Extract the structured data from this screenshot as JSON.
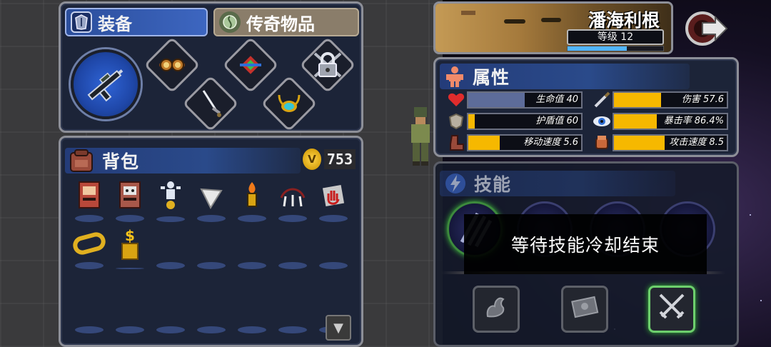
{
  "tabs": {
    "equipment": "装备",
    "legendary_items": "传奇物品"
  },
  "equipment_slots": [
    {
      "name": "weapon",
      "icon": "rifle-icon"
    },
    {
      "name": "goggles",
      "icon": "goggles-icon"
    },
    {
      "name": "gem-staff",
      "icon": "gem-icon"
    },
    {
      "name": "locked",
      "icon": "lock-icon"
    },
    {
      "name": "sword",
      "icon": "sword-icon"
    },
    {
      "name": "amulet",
      "icon": "amulet-icon"
    }
  ],
  "backpack": {
    "title": "背包",
    "coins": "753",
    "coin_symbol": "V",
    "items": [
      {
        "icon": "red-arcade-machine-icon"
      },
      {
        "icon": "skull-arcade-machine-icon"
      },
      {
        "icon": "silver-trophy-figure-icon"
      },
      {
        "icon": "white-triangle-shard-icon"
      },
      {
        "icon": "flame-torch-icon"
      },
      {
        "icon": "spiked-claw-icon"
      },
      {
        "icon": "red-hand-card-icon"
      },
      {
        "icon": "gold-bracelet-icon"
      },
      {
        "icon": "gold-dollar-statue-icon"
      }
    ]
  },
  "character": {
    "name": "潘海利根",
    "level_text": "等级 12",
    "xp_fraction": 0.62
  },
  "attributes": {
    "title": "属性",
    "stats": [
      {
        "label": "生命值 40",
        "icon": "heart-icon",
        "fill": 0.5,
        "color": "blue"
      },
      {
        "label": "伤害 57.6",
        "icon": "knife-icon",
        "fill": 0.42,
        "color": "gold"
      },
      {
        "label": "护盾值 60",
        "icon": "shield-icon",
        "fill": 0.06,
        "color": "gold"
      },
      {
        "label": "暴击率 86.4%",
        "icon": "eye-icon",
        "fill": 0.38,
        "color": "gold"
      },
      {
        "label": "移动速度 5.6",
        "icon": "boot-icon",
        "fill": 0.28,
        "color": "gold"
      },
      {
        "label": "攻击速度 8.5",
        "icon": "gauntlet-icon",
        "fill": 0.45,
        "color": "gold"
      }
    ]
  },
  "skills": {
    "title": "技能",
    "orbs": [
      {
        "icon": "slash-skill-icon"
      },
      {
        "icon": "empty-skill-icon"
      },
      {
        "icon": "empty-skill-icon"
      },
      {
        "icon": "empty-skill-icon"
      }
    ],
    "passives": [
      {
        "icon": "flex-arm-icon"
      },
      {
        "icon": "ammo-crate-icon"
      },
      {
        "icon": "crossed-swords-icon"
      }
    ]
  },
  "toast": {
    "message": "等待技能冷却结束"
  },
  "colors": {
    "panel_bg": "#1c2438",
    "panel_border": "#8d8f98",
    "stat_gold": "#f6b800",
    "stat_blue": "#5d6c9a",
    "xp_blue": "#52b6ff",
    "active_tab": "#2b4e9c"
  }
}
